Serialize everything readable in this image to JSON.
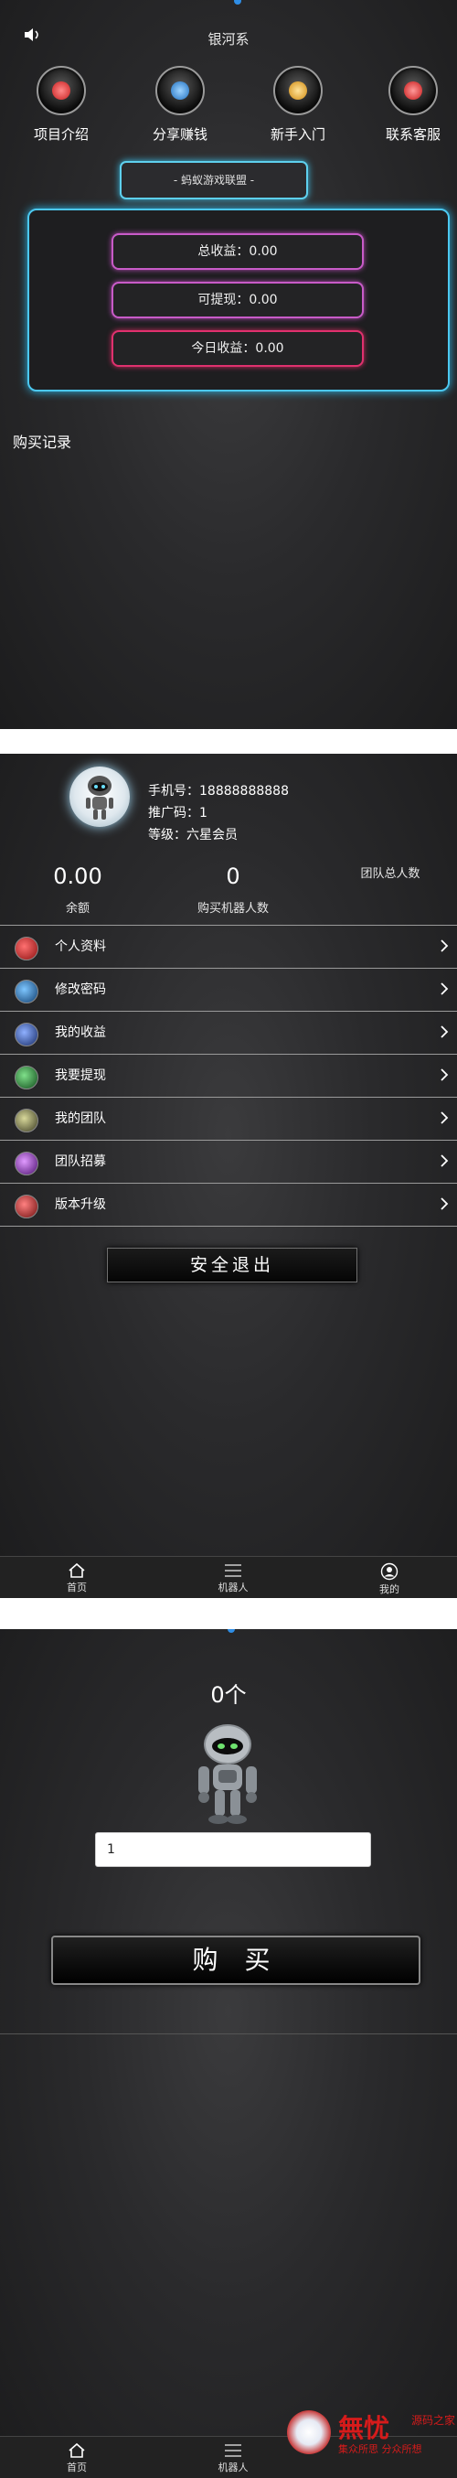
{
  "home": {
    "title": "银河系",
    "features": [
      {
        "label": "项目介绍",
        "icon": "project-intro-icon",
        "color": "#e03c3c"
      },
      {
        "label": "分享赚钱",
        "icon": "share-earn-icon",
        "color": "#3a93d8"
      },
      {
        "label": "新手入门",
        "icon": "beginner-guide-icon",
        "color": "#e0a228"
      },
      {
        "label": "联系客服",
        "icon": "customer-service-icon",
        "color": "#e03c3c"
      }
    ],
    "alliance": "- 蚂蚁游戏联盟 -",
    "stats": {
      "total_income": "总收益：0.00",
      "withdrawable": "可提现：0.00",
      "today_income": "今日收益：0.00"
    },
    "records_title": "购买记录"
  },
  "profile": {
    "phone": "手机号：18888888888",
    "promo_code": "推广码：1",
    "level": "等级：六星会员",
    "team_total_label": "团队总人数",
    "balance_value": "0.00",
    "balance_label": "余额",
    "robots_value": "0",
    "robots_label": "购买机器人数",
    "menu": [
      {
        "label": "个人资料",
        "color": "#c0262b"
      },
      {
        "label": "修改密码",
        "color": "#2a6fa8"
      },
      {
        "label": "我的收益",
        "color": "#2d57a0"
      },
      {
        "label": "我要提现",
        "color": "#2b8a3a"
      },
      {
        "label": "我的团队",
        "color": "#7a7a52"
      },
      {
        "label": "团队招募",
        "color": "#8a2aa8"
      },
      {
        "label": "版本升级",
        "color": "#b8262b"
      }
    ],
    "logout": "安全退出"
  },
  "tabbar": {
    "home": "首页",
    "robot": "机器人",
    "mine": "我的"
  },
  "buy": {
    "count": "0个",
    "quantity_value": "1",
    "buy_label": "购 买"
  },
  "watermark": {
    "logo_text": "無忧",
    "site": "源码之家",
    "slogan": "集众所思 分众所想"
  }
}
